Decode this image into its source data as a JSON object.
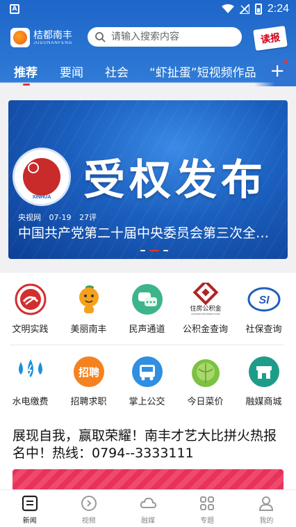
{
  "status_bar": {
    "time": "2:24",
    "left_badge": "A"
  },
  "header": {
    "logo_name": "桔都南丰",
    "logo_sub": "JUDUNANFENG",
    "search_placeholder": "请输入搜索内容",
    "dubao_label": "读报"
  },
  "tabs": [
    {
      "label": "推荐",
      "active": true
    },
    {
      "label": "要闻"
    },
    {
      "label": "社会"
    },
    {
      "label": "“虾扯蛋”短视频作品"
    }
  ],
  "plus_symbol": "+",
  "banner": {
    "title": "受权发布",
    "emblem_text": "XINHUA",
    "source": "央视网",
    "date": "07-19",
    "comments": "27评",
    "headline": "中国共产党第二十届中央委员会第三次全…"
  },
  "services_row1": [
    {
      "label": "文明实践",
      "icon": "civilization-practice-icon"
    },
    {
      "label": "美丽南丰",
      "icon": "orange-mascot-icon"
    },
    {
      "label": "民声通道",
      "icon": "chat-bubbles-icon"
    },
    {
      "label": "公积金查询",
      "icon": "housing-fund-icon"
    },
    {
      "label": "社保查询",
      "icon": "social-security-icon"
    }
  ],
  "services_row2": [
    {
      "label": "水电缴费",
      "icon": "water-electricity-icon"
    },
    {
      "label": "招聘求职",
      "icon": "recruitment-icon",
      "icon_text": "招聘"
    },
    {
      "label": "掌上公交",
      "icon": "bus-icon"
    },
    {
      "label": "今日菜价",
      "icon": "cabbage-icon"
    },
    {
      "label": "融媒商城",
      "icon": "shop-icon"
    }
  ],
  "housing_fund_mini": "住房公积金",
  "housing_fund_mini_en": "HOUSING PROVIDENT FUND",
  "news": {
    "title": "展现自我，赢取荣耀！南丰才艺大比拼火热报名中！热线：0794--3333111"
  },
  "bottom_nav": [
    {
      "label": "新闻",
      "icon": "news-icon",
      "active": true
    },
    {
      "label": "视频",
      "icon": "video-icon"
    },
    {
      "label": "融媒",
      "icon": "cloud-icon"
    },
    {
      "label": "专题",
      "icon": "topics-grid-icon"
    },
    {
      "label": "我的",
      "icon": "profile-icon"
    }
  ],
  "colors": {
    "primary_blue": "#2f7bd6",
    "accent_red": "#e8352c"
  }
}
